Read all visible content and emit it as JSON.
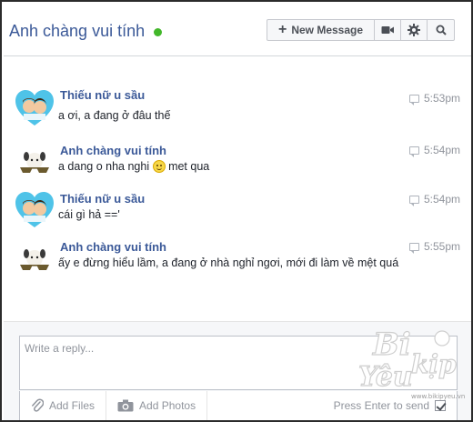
{
  "header": {
    "title": "Anh chàng vui tính",
    "new_message_label": "New Message",
    "icons": [
      "video-icon",
      "gear-icon",
      "search-icon"
    ]
  },
  "messages": [
    {
      "sender": "Thiếu nữ u sầu",
      "text": "a ơi, a đang ở đâu thế",
      "time": "5:53pm",
      "avatar": "couple-heart-avatar"
    },
    {
      "sender": "Anh chàng vui tính",
      "text_before": "a dang o nha nghi",
      "text_after": "met qua",
      "time": "5:54pm",
      "avatar": "puppy-sunglasses-avatar"
    },
    {
      "sender": "Thiếu nữ u sầu",
      "text": "cái gì hả =='",
      "time": "5:54pm",
      "avatar": "couple-heart-avatar"
    },
    {
      "sender": "Anh chàng vui tính",
      "text": "ấy e đừng hiểu lầm, a đang ở nhà nghỉ ngơi, mới đi làm về mệt quá",
      "time": "5:55pm",
      "avatar": "puppy-sunglasses-avatar"
    }
  ],
  "composer": {
    "placeholder": "Write a reply...",
    "add_files_label": "Add Files",
    "add_photos_label": "Add Photos",
    "press_enter_label": "Press Enter to send",
    "press_enter_checked": true
  },
  "watermark": {
    "line1": "Bi",
    "line2": "Yêu",
    "line3": "kịp",
    "url": "www.bikipyeu.vn"
  },
  "colors": {
    "link_blue": "#3b5998",
    "online_green": "#42b72a",
    "timestamp_gray": "#90949c"
  }
}
